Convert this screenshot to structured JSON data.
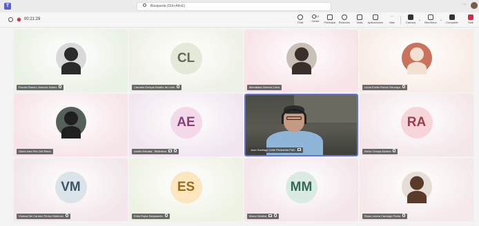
{
  "titlebar": {
    "search_placeholder": "Búsqueda (Ctrl+Alt+E)",
    "more": "···"
  },
  "meeting": {
    "timer": "00:21:29"
  },
  "toolbar": {
    "chat": "Chat",
    "people": "Gente",
    "people_count": "12",
    "raise": "Participar",
    "react": "Reacción",
    "view": "Vista",
    "apps": "Aplicaciones",
    "more": "Más",
    "camera": "Cámara",
    "mic": "Micrófono",
    "share": "Compartir",
    "leave": "Salir"
  },
  "participants": [
    {
      "name": "Ronald Ramiro Jimenez Nuñez",
      "type": "photo",
      "muted": true,
      "bg": "#eaf1e5",
      "photo_bg": "#d9d9d9",
      "photo_fg": "#2b2b2b"
    },
    {
      "name": "Carmelo Enrique Bolaño de León",
      "type": "initials",
      "initials": "CL",
      "muted": true,
      "bg": "#eef1e7",
      "circle": "#e5e9da",
      "ink": "#5f6b55"
    },
    {
      "name": "Mercalasa Herrera Coba",
      "type": "photo",
      "muted": false,
      "bg": "#f7e3e8",
      "photo_bg": "#c9c1b8",
      "photo_fg": "#3a2f2a"
    },
    {
      "name": "Linda Evelin Pichon Rencayo",
      "type": "photo",
      "muted": true,
      "bg": "#f8ece6",
      "photo_bg": "#c9735b",
      "photo_fg": "#f3e2d4"
    },
    {
      "name": "Gloria Ines Pino Del Risco",
      "type": "photo",
      "muted": false,
      "bg": "#f6e4e8",
      "photo_bg": "#56605a",
      "photo_fg": "#1f1f1f"
    },
    {
      "name": "Adolfo Estrada - Biblioteca",
      "type": "initials",
      "initials": "AE",
      "muted": true,
      "share": true,
      "bg": "#f1e6f0",
      "circle": "#f4d9ea",
      "ink": "#8a3f72"
    },
    {
      "name": "Juan Santiago Calle Piedrahita PhD.",
      "type": "video",
      "muted": false,
      "share": true,
      "speaking": true
    },
    {
      "name": "Rocio Crespo Alvarez",
      "type": "initials",
      "initials": "RA",
      "muted": true,
      "bg": "#f4e7ea",
      "circle": "#f7d6db",
      "ink": "#a23a4a"
    },
    {
      "name": "Viviana Del Carmen Pertuz Martínez",
      "type": "initials",
      "initials": "VM",
      "muted": true,
      "bg": "#f2e6ea",
      "circle": "#dbe4ea",
      "ink": "#3c5566"
    },
    {
      "name": "Erika Rojas Sanjuanelo",
      "type": "initials",
      "initials": "ES",
      "muted": true,
      "bg": "#eef2e3",
      "circle": "#fbe6bf",
      "ink": "#9a6a18"
    },
    {
      "name": "Marco Medina",
      "type": "initials",
      "initials": "MM",
      "muted": true,
      "share": true,
      "bg": "#f3e5ea",
      "circle": "#d9ebe2",
      "ink": "#356b55"
    },
    {
      "name": "Rosa Lorena Camargo Pardo",
      "type": "photo",
      "muted": true,
      "bg": "#f5e9ea",
      "photo_bg": "#e6ddd6",
      "photo_fg": "#5a3a2a"
    }
  ]
}
